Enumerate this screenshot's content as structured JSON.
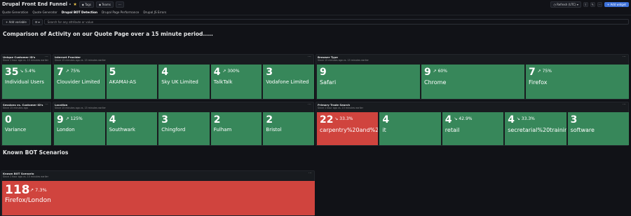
{
  "header": {
    "title": "Drupal Front End Funnel -",
    "tags_label": "Tags",
    "teams_label": "Teams",
    "refresh_label": "Refresh (UTC)",
    "add_widget_label": "+ Add widget"
  },
  "tabs": [
    {
      "label": "Quote Generation"
    },
    {
      "label": "Quote Generator"
    },
    {
      "label": "Drupal BOT Detection"
    },
    {
      "label": "Drupal Page Performance"
    },
    {
      "label": "Drupal JS Errors"
    }
  ],
  "toolbar": {
    "add_variable_label": "+ Add variable",
    "search_placeholder": "Search for any attribute or value"
  },
  "headings": {
    "main": "Comparison of Activity on our Quote Page over a 15 minute period.....",
    "bots": "Known BOT Scenarios"
  },
  "panels": [
    {
      "title": "Unique Customer ID's",
      "subtitle": "Since 1 hour ago vs. 15 minutes earlier",
      "tiles": [
        {
          "value": "35",
          "delta": "↘ 5.4%",
          "label": "Individual Users",
          "status": "ok"
        }
      ]
    },
    {
      "title": "Internet Provider",
      "subtitle": "Since 15 minutes ago vs. 15 minutes earlier",
      "tiles": [
        {
          "value": "7",
          "delta": "↗ 75%",
          "label": "Clouvider Limited",
          "status": "ok"
        },
        {
          "value": "5",
          "delta": "",
          "label": "AKAMAI-AS",
          "status": "ok"
        },
        {
          "value": "4",
          "delta": "",
          "label": "Sky UK Limited",
          "status": "ok"
        },
        {
          "value": "4",
          "delta": "↗ 300%",
          "label": "TalkTalk",
          "status": "ok"
        },
        {
          "value": "3",
          "delta": "",
          "label": "Vodafone Limited",
          "status": "ok"
        }
      ]
    },
    {
      "title": "Browser Type",
      "subtitle": "Since 15 minutes ago vs. 15 minutes earlier",
      "tiles": [
        {
          "value": "9",
          "delta": "",
          "label": "Safari",
          "status": "ok"
        },
        {
          "value": "9",
          "delta": "↗ 60%",
          "label": "Chrome",
          "status": "ok"
        },
        {
          "value": "7",
          "delta": "↗ 75%",
          "label": "Firefox",
          "status": "ok"
        }
      ]
    },
    {
      "title": "Sessions vs. Customer ID's",
      "subtitle": "Since 15 minutes ago",
      "tiles": [
        {
          "value": "0",
          "delta": "",
          "label": "Variance",
          "status": "ok"
        }
      ]
    },
    {
      "title": "Location",
      "subtitle": "Since 15 minutes ago vs. 15 minutes earlier",
      "tiles": [
        {
          "value": "9",
          "delta": "↗ 125%",
          "label": "London",
          "status": "ok"
        },
        {
          "value": "4",
          "delta": "",
          "label": "Southwark",
          "status": "ok"
        },
        {
          "value": "3",
          "delta": "",
          "label": "Chingford",
          "status": "ok"
        },
        {
          "value": "2",
          "delta": "",
          "label": "Fulham",
          "status": "ok"
        },
        {
          "value": "2",
          "delta": "",
          "label": "Bristol",
          "status": "ok"
        }
      ]
    },
    {
      "title": "Primary Trade Search",
      "subtitle": "Since 1 hour ago vs. 15 minutes earlier",
      "tiles": [
        {
          "value": "22",
          "delta": "↘ 33.3%",
          "label": "carpentry%20and%20joinery",
          "status": "critical"
        },
        {
          "value": "4",
          "delta": "",
          "label": "it",
          "status": "ok"
        },
        {
          "value": "4",
          "delta": "↘ 42.9%",
          "label": "retail",
          "status": "ok"
        },
        {
          "value": "4",
          "delta": "↘ 33.3%",
          "label": "secretarial%20training",
          "status": "ok"
        },
        {
          "value": "3",
          "delta": "",
          "label": "software",
          "status": "ok"
        }
      ]
    },
    {
      "title": "Known BOT Scenario",
      "subtitle": "Since 1 hour ago vs. 15 minutes earlier",
      "tiles": [
        {
          "value": "118",
          "delta": "↗ 7.3%",
          "label": "Firefox/London",
          "status": "critical"
        }
      ]
    }
  ],
  "colors": {
    "ok": "#37875a",
    "critical": "#d0443e",
    "background": "#111217"
  }
}
